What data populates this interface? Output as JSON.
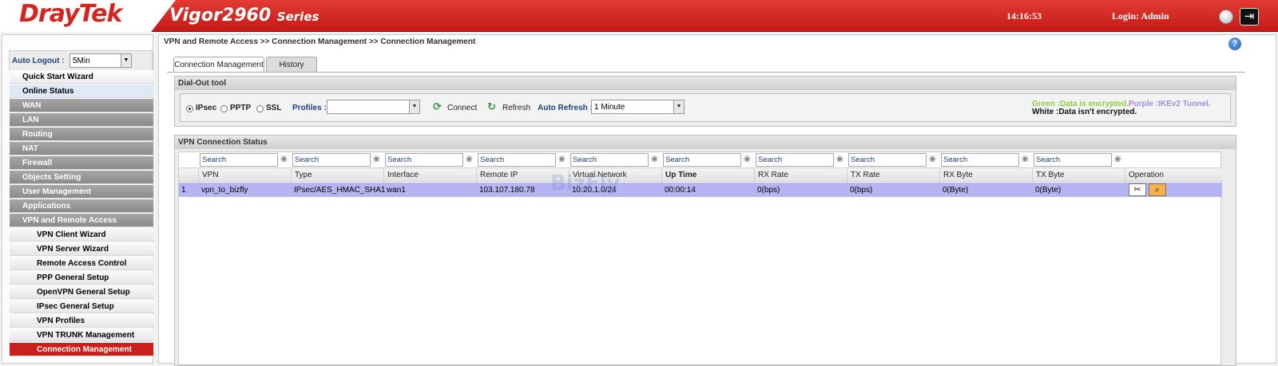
{
  "header": {
    "brand": "DrayTek",
    "product": "Vigor2960",
    "series": "Series",
    "time": "14:16:53",
    "login": "Login: Admin"
  },
  "sidebar": {
    "autologout_label": "Auto Logout :",
    "autologout_value": "5Min",
    "items": [
      {
        "label": "Quick Start Wizard",
        "style": "light"
      },
      {
        "label": "Online Status",
        "style": "blue"
      },
      {
        "label": "WAN",
        "style": "gray"
      },
      {
        "label": "LAN",
        "style": "gray"
      },
      {
        "label": "Routing",
        "style": "gray"
      },
      {
        "label": "NAT",
        "style": "gray"
      },
      {
        "label": "Firewall",
        "style": "gray"
      },
      {
        "label": "Objects Setting",
        "style": "gray"
      },
      {
        "label": "User Management",
        "style": "gray"
      },
      {
        "label": "Applications",
        "style": "gray"
      },
      {
        "label": "VPN and Remote Access",
        "style": "gray"
      },
      {
        "label": "VPN Client Wizard",
        "style": "sub"
      },
      {
        "label": "VPN Server Wizard",
        "style": "sub"
      },
      {
        "label": "Remote Access Control",
        "style": "sub"
      },
      {
        "label": "PPP General Setup",
        "style": "sub"
      },
      {
        "label": "OpenVPN General Setup",
        "style": "sub"
      },
      {
        "label": "IPsec General Setup",
        "style": "sub"
      },
      {
        "label": "VPN Profiles",
        "style": "sub"
      },
      {
        "label": "VPN TRUNK Management",
        "style": "sub"
      },
      {
        "label": "Connection Management",
        "style": "active"
      }
    ]
  },
  "main": {
    "breadcrumb": "VPN and Remote Access >> Connection Management >> Connection Management",
    "tabs": [
      "Connection Management",
      "History"
    ],
    "dialout": {
      "title": "Dial-Out tool",
      "protocols": [
        "IPsec",
        "PPTP",
        "SSL"
      ],
      "selected_protocol": "IPsec",
      "profiles_label": "Profiles :",
      "profiles_value": "",
      "connect_label": "Connect",
      "refresh_label": "Refresh",
      "auto_refresh_label": "Auto Refresh :",
      "auto_refresh_value": "1 Minute",
      "legend_green": "Green :Data is encrypted.",
      "legend_purple": "Purple :IKEv2 Tunnel.",
      "legend_white": "White :Data isn't encrypted."
    },
    "status": {
      "title": "VPN Connection Status",
      "search_placeholder": "Search",
      "columns": [
        "VPN",
        "Type",
        "Interface",
        "Remote IP",
        "Virtual Network",
        "Up Time",
        "RX Rate",
        "TX Rate",
        "RX Byte",
        "TX Byte",
        "Operation"
      ],
      "rows": [
        {
          "index": "1",
          "vpn": "vpn_to_bizfly",
          "type": "IPsec/AES_HMAC_SHA1",
          "interface": "wan1",
          "remote_ip": "103.107.180.78",
          "virtual_network": "10.20.1.0/24",
          "up_time": "00:00:14",
          "rx_rate": "0(bps)",
          "tx_rate": "0(bps)",
          "rx_byte": "0(Byte)",
          "tx_byte": "0(Byte)"
        }
      ],
      "watermark": "BizFly"
    }
  }
}
